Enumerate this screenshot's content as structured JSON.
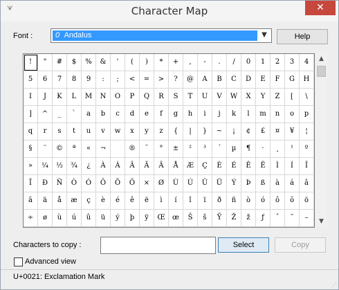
{
  "window": {
    "title": "Character Map",
    "app_icon": "character-map-icon",
    "close_glyph": "✕"
  },
  "font": {
    "label": "Font :",
    "selected": "Andalus",
    "font_icon_glyph": "0",
    "options_visible": [
      "Andalus"
    ]
  },
  "buttons": {
    "help": "Help",
    "select": "Select",
    "copy": "Copy"
  },
  "grid": {
    "selected_index": 0,
    "rows": [
      [
        "!",
        "\"",
        "#",
        "$",
        "%",
        "&",
        "'",
        "(",
        ")",
        "*",
        "+",
        ",",
        "-",
        ".",
        "/",
        "0",
        "1",
        "2",
        "3",
        "4"
      ],
      [
        "5",
        "6",
        "7",
        "8",
        "9",
        ":",
        ";",
        "<",
        "=",
        ">",
        "?",
        "@",
        "A",
        "B",
        "C",
        "D",
        "E",
        "F",
        "G",
        "H"
      ],
      [
        "I",
        "J",
        "K",
        "L",
        "M",
        "N",
        "O",
        "P",
        "Q",
        "R",
        "S",
        "T",
        "U",
        "V",
        "W",
        "X",
        "Y",
        "Z",
        "[",
        "\\"
      ],
      [
        "]",
        "^",
        "_",
        "`",
        "a",
        "b",
        "c",
        "d",
        "e",
        "f",
        "g",
        "h",
        "i",
        "j",
        "k",
        "l",
        "m",
        "n",
        "o",
        "p"
      ],
      [
        "q",
        "r",
        "s",
        "t",
        "u",
        "v",
        "w",
        "x",
        "y",
        "z",
        "{",
        "|",
        "}",
        "~",
        "¡",
        "¢",
        "£",
        "¤",
        "¥",
        "¦"
      ],
      [
        "§",
        "¨",
        "©",
        "ª",
        "«",
        "¬",
        "­",
        "®",
        "¯",
        "°",
        "±",
        "²",
        "³",
        "´",
        "µ",
        "¶",
        "·",
        "¸",
        "¹",
        "º"
      ],
      [
        "»",
        "¼",
        "½",
        "¾",
        "¿",
        "À",
        "Á",
        "Â",
        "Ã",
        "Ä",
        "Å",
        "Æ",
        "Ç",
        "È",
        "É",
        "Ê",
        "Ë",
        "Ì",
        "Í",
        "Î"
      ],
      [
        "Ï",
        "Ð",
        "Ñ",
        "Ò",
        "Ó",
        "Ô",
        "Õ",
        "Ö",
        "×",
        "Ø",
        "Ù",
        "Ú",
        "Û",
        "Ü",
        "Ý",
        "Þ",
        "ß",
        "à",
        "á",
        "â"
      ],
      [
        "ã",
        "ä",
        "å",
        "æ",
        "ç",
        "è",
        "é",
        "ê",
        "ë",
        "ì",
        "í",
        "î",
        "ï",
        "ð",
        "ñ",
        "ò",
        "ó",
        "ô",
        "õ",
        "ö"
      ],
      [
        "÷",
        "ø",
        "ù",
        "ú",
        "û",
        "ü",
        "ý",
        "þ",
        "ÿ",
        "Œ",
        "œ",
        "Š",
        "š",
        "Ÿ",
        "Ž",
        "ž",
        "ƒ",
        "ˆ",
        "˜",
        "–"
      ]
    ]
  },
  "copy_field": {
    "label": "Characters to copy :",
    "value": ""
  },
  "advanced": {
    "label": "Advanced view",
    "checked": false
  },
  "status": {
    "text": "U+0021: Exclamation Mark"
  },
  "colors": {
    "selection_blue": "#3399ff",
    "close_red": "#c7473d",
    "window_bg": "#eeeeee"
  }
}
